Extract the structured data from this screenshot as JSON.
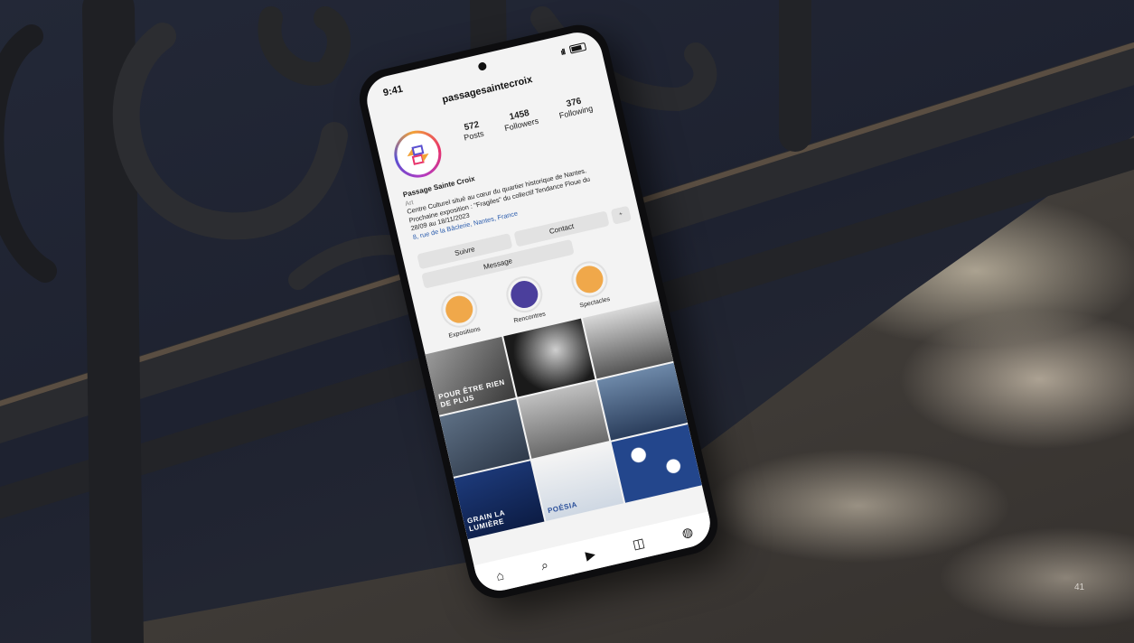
{
  "page_number": "41",
  "profile": {
    "time": "9:41",
    "signal": "ıll",
    "handle": "passagesaintecroix",
    "stats": [
      {
        "value": "572",
        "label": "Posts"
      },
      {
        "value": "1458",
        "label": "Followers"
      },
      {
        "value": "376",
        "label": "Following"
      }
    ],
    "name": "Passage Sainte Croix",
    "category": "Art",
    "bio_line1": "Centre Culturel situé au cœur du quartier historique de Nantes.",
    "bio_line2": "Prochaine exposition : \"Fragiles\" du collectif Tendance Floue du",
    "bio_line3": "28/09 au 18/11/2023",
    "address": "8, rue de la Bâclerie, Nantes, France",
    "buttons": {
      "follow": "Suivre",
      "contact": "Contact",
      "message": "Message",
      "more": "⁺⁂"
    },
    "highlights": [
      {
        "label": "Expositions",
        "color": "#f0a84a"
      },
      {
        "label": "Rencontres",
        "color": "#4b3f9c"
      },
      {
        "label": "Spectacles",
        "color": "#f0a84a"
      }
    ],
    "grid_texts": [
      "POUR ÊTRE RIEN DE PLUS",
      "GRAIN LA LUMIÈRE",
      "POÉSIA"
    ],
    "nav_icons": [
      "home-icon",
      "search-icon",
      "reels-icon",
      "shop-icon",
      "profile-icon"
    ]
  }
}
